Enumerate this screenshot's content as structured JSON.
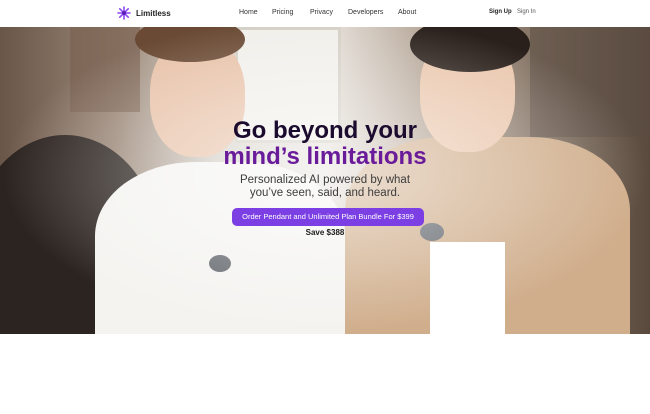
{
  "brand": {
    "name": "Limitless",
    "accent": "#7b3fe4"
  },
  "nav": {
    "links": [
      "Home",
      "Pricing",
      "Privacy",
      "Developers",
      "About"
    ],
    "sign_up": "Sign Up",
    "sign_in": "Sign In"
  },
  "hero": {
    "headline_line1": "Go beyond your",
    "headline_line2": "mind’s limitations",
    "subhead_line1": "Personalized AI powered by what",
    "subhead_line2": "you’ve seen, said, and heard.",
    "cta_label": "Order Pendant and Unlimited Plan Bundle For $399",
    "save_label": "Save $388"
  }
}
